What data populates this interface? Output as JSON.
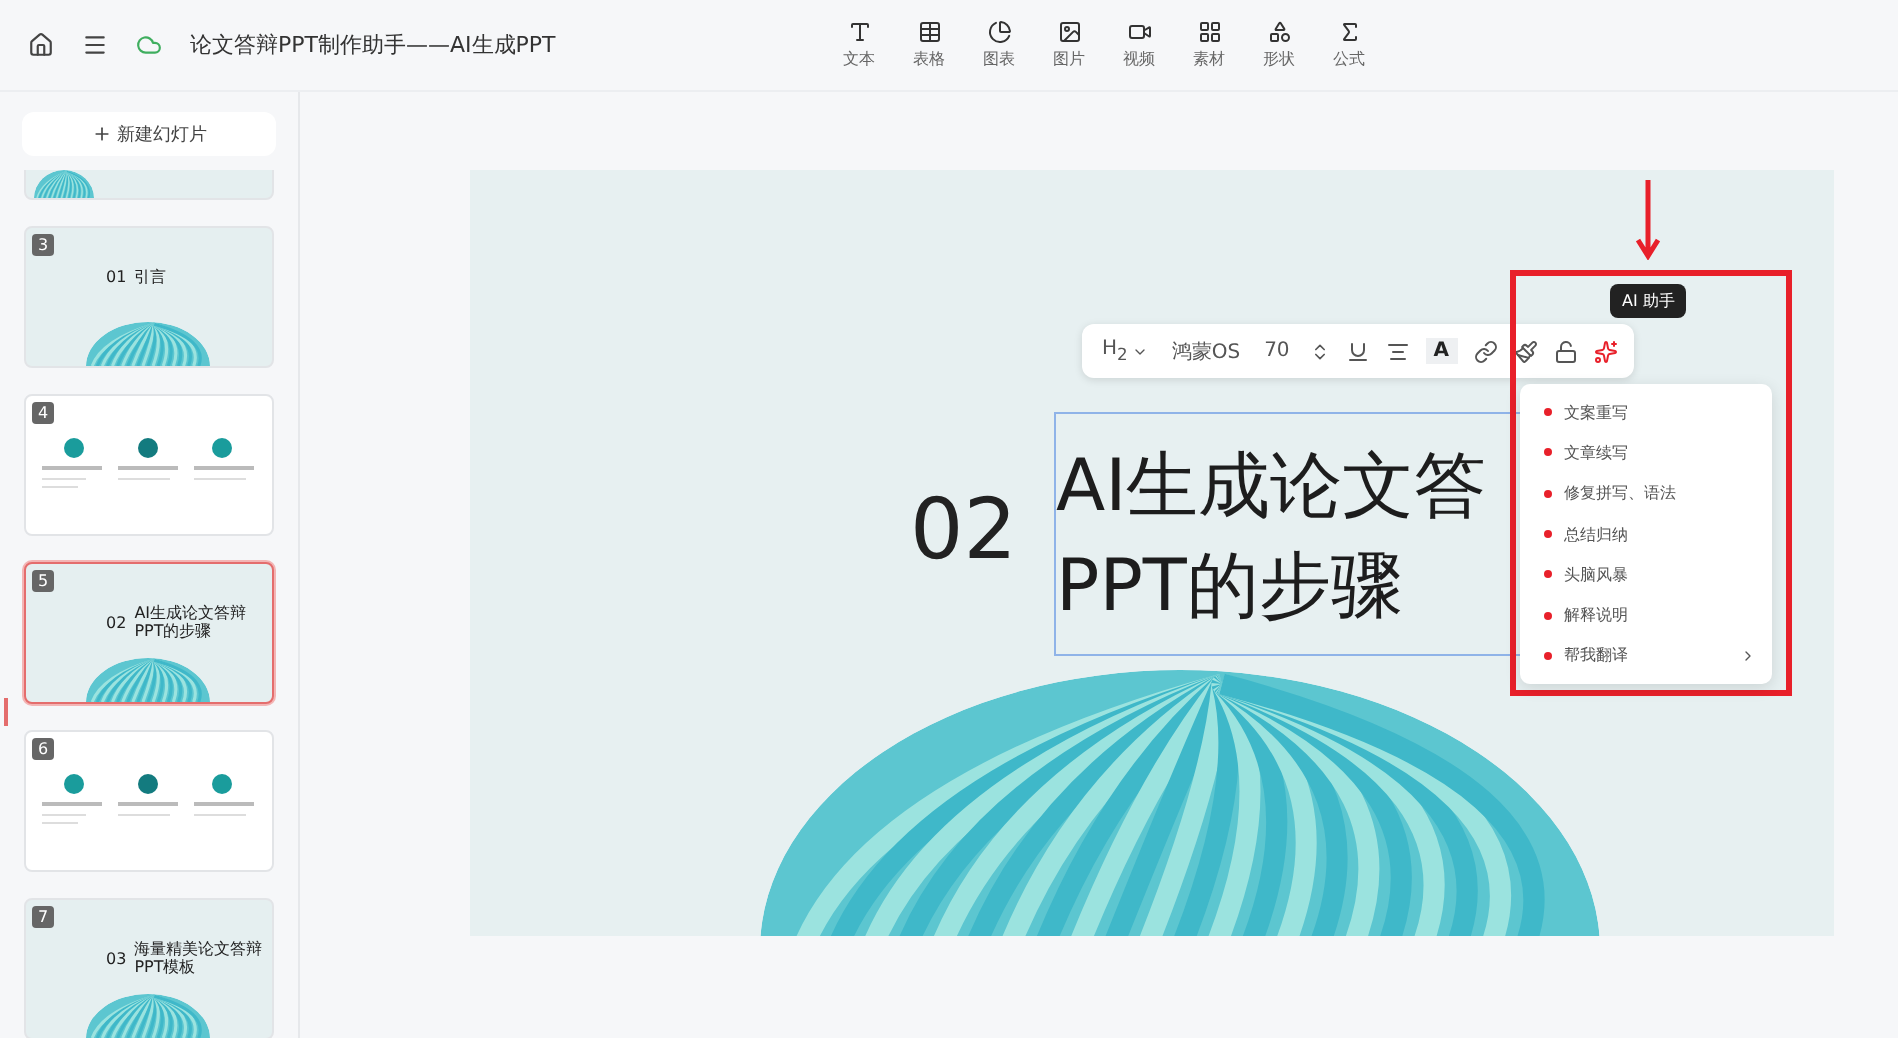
{
  "header": {
    "doc_title": "论文答辩PPT制作助手——AI生成PPT"
  },
  "tools": [
    {
      "kind": "text",
      "label": "文本"
    },
    {
      "kind": "table",
      "label": "表格"
    },
    {
      "kind": "chart",
      "label": "图表"
    },
    {
      "kind": "image",
      "label": "图片"
    },
    {
      "kind": "video",
      "label": "视频"
    },
    {
      "kind": "assets",
      "label": "素材"
    },
    {
      "kind": "shape",
      "label": "形状"
    },
    {
      "kind": "formula",
      "label": "公式"
    }
  ],
  "sidebar": {
    "new_slide": "新建幻灯片",
    "slides": [
      {
        "kind": "partial",
        "selected": false
      },
      {
        "kind": "title",
        "number": "3",
        "index": "01",
        "title_lines": [
          "引言"
        ],
        "selected": false
      },
      {
        "kind": "content",
        "number": "4",
        "selected": false
      },
      {
        "kind": "title",
        "number": "5",
        "index": "02",
        "title_lines": [
          "AI生成论文答辩",
          "PPT的步骤"
        ],
        "selected": true
      },
      {
        "kind": "content",
        "number": "6",
        "selected": false
      },
      {
        "kind": "title",
        "number": "7",
        "index": "03",
        "title_lines": [
          "海量精美论文答辩",
          "PPT模板"
        ],
        "selected": false
      }
    ]
  },
  "slide": {
    "index": "02",
    "title_lines": [
      "AI生成论文答",
      "PPT的步骤"
    ]
  },
  "format_bar": {
    "heading": "H$_{2}$",
    "font": "鸿蒙OS",
    "size": "70",
    "color_letter": "A"
  },
  "tooltip": "AI 助手",
  "ai_menu": [
    {
      "label": "文案重写",
      "has_submenu": false
    },
    {
      "label": "文章续写",
      "has_submenu": false
    },
    {
      "label": "修复拼写、语法",
      "has_submenu": false
    },
    {
      "label": "总结归纳",
      "has_submenu": false
    },
    {
      "label": "头脑风暴",
      "has_submenu": false
    },
    {
      "label": "解释说明",
      "has_submenu": false
    },
    {
      "label": "帮我翻译",
      "has_submenu": true
    }
  ]
}
